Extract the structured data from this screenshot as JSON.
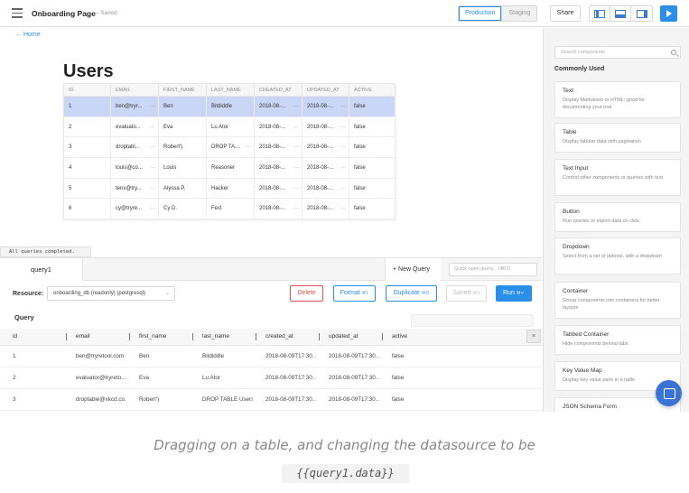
{
  "topbar": {
    "page_name": "Onboarding Page",
    "saved": "— Saved",
    "env_production": "Production",
    "env_staging": "Staging",
    "share": "Share"
  },
  "canvas": {
    "home_link": "← Home",
    "title": "Users",
    "table": {
      "headers": [
        "ID",
        "EMAIL",
        "FIRST_NAME",
        "LAST_NAME",
        "CREATED_AT",
        "UPDATED_AT",
        "ACTIVE"
      ],
      "rows": [
        {
          "id": "1",
          "email": "ben@tryr...",
          "first_name": "Ben",
          "last_name": "Bitdiddle",
          "created_at": "2018-08-...",
          "updated_at": "2018-08-...",
          "active": "false"
        },
        {
          "id": "2",
          "email": "evaluato...",
          "first_name": "Eva",
          "last_name": "Lu Ator",
          "created_at": "2018-08-...",
          "updated_at": "2018-08-...",
          "active": "false"
        },
        {
          "id": "3",
          "email": "droptabl...",
          "first_name": "Robert')",
          "last_name": "DROP TA...",
          "created_at": "2018-08-...",
          "updated_at": "2018-08-...",
          "active": "false"
        },
        {
          "id": "4",
          "email": "louis@co...",
          "first_name": "Louis",
          "last_name": "Reasoner",
          "created_at": "2018-08-...",
          "updated_at": "2018-08-...",
          "active": "false"
        },
        {
          "id": "5",
          "email": "tenx@try...",
          "first_name": "Alyssa P.",
          "last_name": "Hacker",
          "created_at": "2018-08-...",
          "updated_at": "2018-08-...",
          "active": "false"
        },
        {
          "id": "6",
          "email": "cy@tryre...",
          "first_name": "Cy D.",
          "last_name": "Fect",
          "created_at": "2018-08-...",
          "updated_at": "2018-08-...",
          "active": "false"
        }
      ]
    },
    "status": "All queries completed."
  },
  "query_panel": {
    "tab": "query1",
    "new_query": "+ New Query",
    "quick_open_placeholder": "Quick open query... (⌘O)",
    "resource_label": "Resource:",
    "resource_value": "onboarding_db (readonly) (postgresql)",
    "delete": "Delete",
    "format": "Format",
    "format_kbd": "⌘L",
    "duplicate": "Duplicate",
    "duplicate_kbd": "⌘D",
    "saved": "Saved",
    "saved_kbd": "⌘S",
    "run": "Run",
    "run_kbd": "⌘↵",
    "query_label": "Query",
    "results": {
      "headers": [
        "id",
        "email",
        "first_name",
        "last_name",
        "created_at",
        "updated_at",
        "active"
      ],
      "rows": [
        {
          "id": "1",
          "email": "ben@tryretool.com",
          "first_name": "Ben",
          "last_name": "Bitdiddle",
          "created_at": "2018-08-09T17:30...",
          "updated_at": "2018-08-09T17:30...",
          "active": "false"
        },
        {
          "id": "2",
          "email": "evaluator@tryreto...",
          "first_name": "Eva",
          "last_name": "Lu Ator",
          "created_at": "2018-08-09T17:30...",
          "updated_at": "2018-08-09T17:30...",
          "active": "false"
        },
        {
          "id": "3",
          "email": "droptable@xkcd.co...",
          "first_name": "Robert')",
          "last_name": "DROP TABLE Users;",
          "created_at": "2018-08-09T17:30...",
          "updated_at": "2018-08-09T17:30...",
          "active": "false"
        }
      ]
    },
    "close": "×"
  },
  "components": {
    "search_placeholder": "Search components",
    "section_title": "Commonly Used",
    "items": [
      {
        "name": "Text",
        "desc": "Display Markdown or HTML; good for documenting your tool"
      },
      {
        "name": "Table",
        "desc": "Display tabular data with pagination"
      },
      {
        "name": "Text Input",
        "desc": "Control other components or queries with text"
      },
      {
        "name": "Button",
        "desc": "Run queries or export data on click"
      },
      {
        "name": "Dropdown",
        "desc": "Select from a set of options, with a dropdown"
      },
      {
        "name": "Container",
        "desc": "Group components into containers for better layouts"
      },
      {
        "name": "Tabbed Container",
        "desc": "Hide components behind tabs"
      },
      {
        "name": "Key Value Map",
        "desc": "Display key value pairs in a table"
      },
      {
        "name": "JSON Schema Form",
        "desc": ""
      }
    ]
  },
  "caption": {
    "text": "Dragging on a table, and changing the datasource to be",
    "code": "{{query1.data}}"
  },
  "colors": {
    "accent": "#2a8fe8",
    "danger": "#e05050",
    "selected_row": "#c9d6f5"
  }
}
